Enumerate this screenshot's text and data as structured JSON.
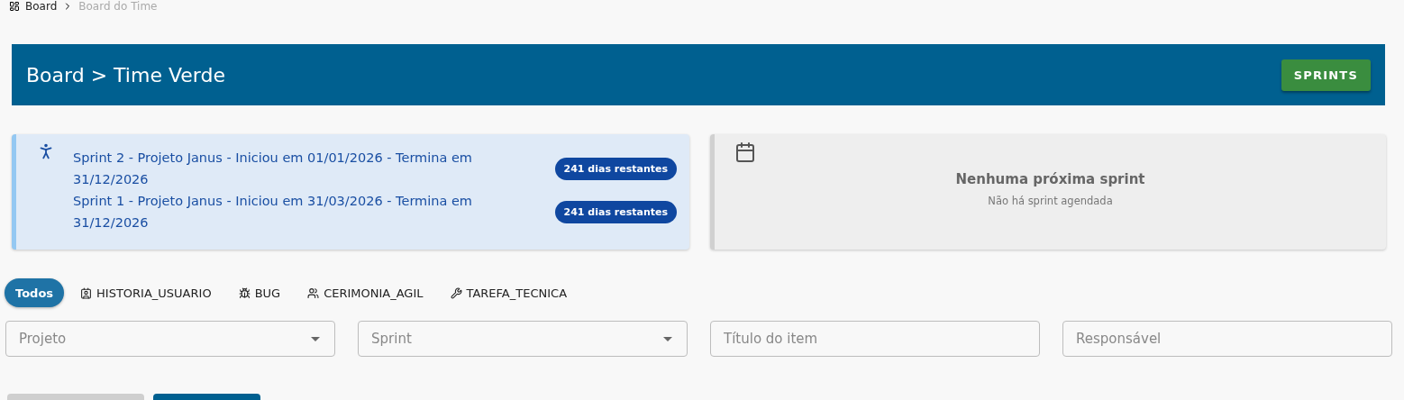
{
  "breadcrumb": [
    {
      "label": "Board",
      "current": false
    },
    {
      "label": "Board do Time",
      "current": true
    }
  ],
  "header": {
    "title": "Board > Time Verde",
    "button": "SPRINTS"
  },
  "active_sprints": [
    {
      "text": "Sprint 2 - Projeto Janus - Iniciou em 01/01/2026 - Termina em 31/12/2026",
      "badge": "241 dias restantes"
    },
    {
      "text": "Sprint 1 - Projeto Janus - Iniciou em 31/03/2026 - Termina em 31/12/2026",
      "badge": "241 dias restantes"
    }
  ],
  "next_sprint": {
    "title": "Nenhuma próxima sprint",
    "subtitle": "Não há sprint agendada"
  },
  "type_filters": [
    {
      "label": "Todos",
      "kind": "all",
      "selected": true
    },
    {
      "label": "HISTORIA_USUARIO",
      "kind": "story",
      "selected": false
    },
    {
      "label": "BUG",
      "kind": "bug",
      "selected": false
    },
    {
      "label": "CERIMONIA_AGIL",
      "kind": "ceremony",
      "selected": false
    },
    {
      "label": "TAREFA_TECNICA",
      "kind": "task",
      "selected": false
    }
  ],
  "filters": [
    {
      "placeholder": "Projeto",
      "kind": "select"
    },
    {
      "placeholder": "Sprint",
      "kind": "select"
    },
    {
      "placeholder": "Título do item",
      "kind": "text"
    },
    {
      "placeholder": "Responsável",
      "kind": "text"
    }
  ]
}
